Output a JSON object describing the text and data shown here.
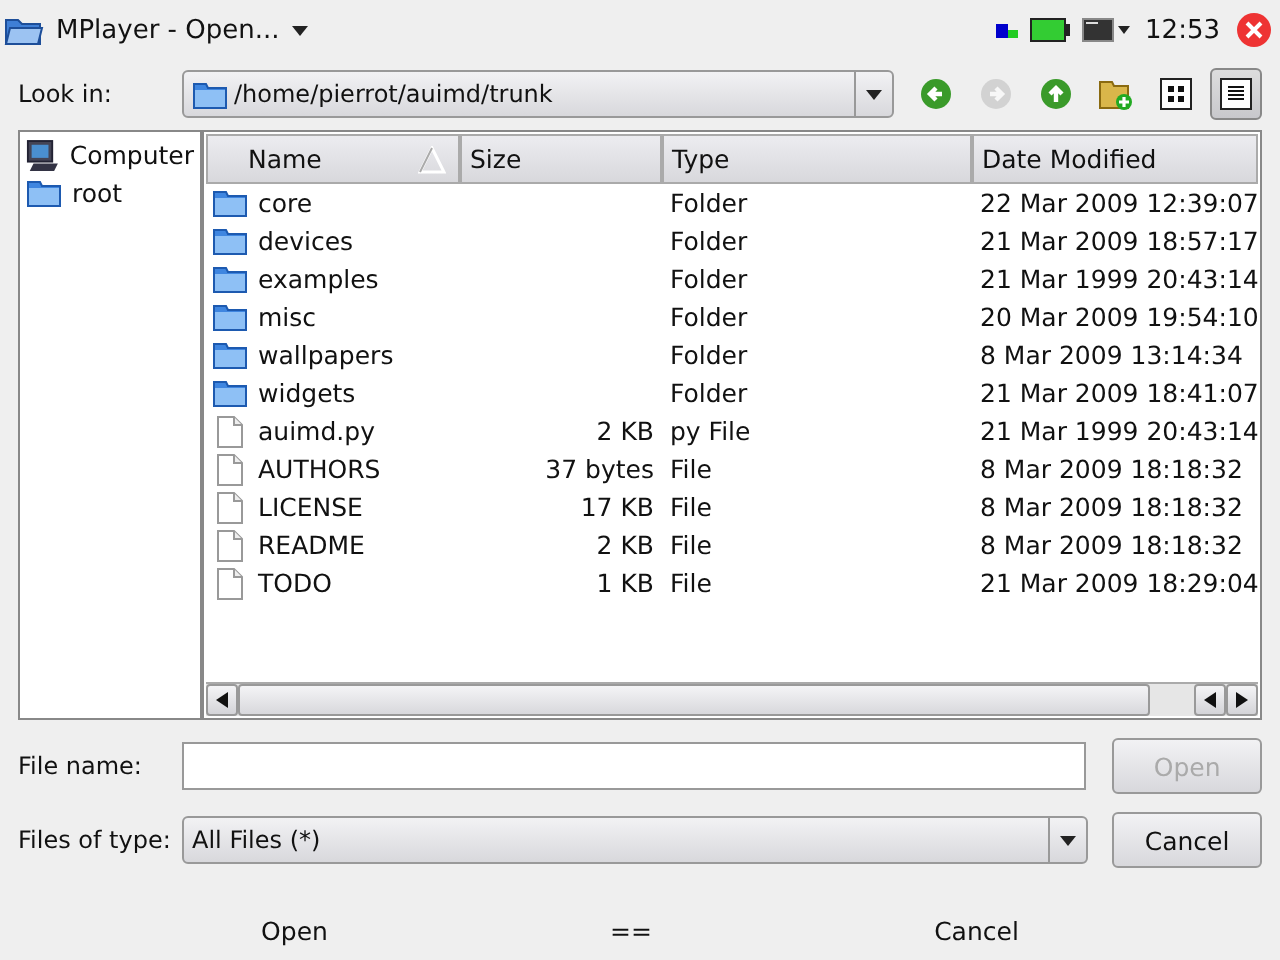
{
  "window": {
    "title": "MPlayer - Open..."
  },
  "status": {
    "time": "12:53"
  },
  "look_in": {
    "label": "Look in:",
    "path": "/home/pierrot/auimd/trunk"
  },
  "toolbar": [
    {
      "kind": "back",
      "disabled": false,
      "selected": false
    },
    {
      "kind": "forward",
      "disabled": true,
      "selected": false
    },
    {
      "kind": "up",
      "disabled": false,
      "selected": false
    },
    {
      "kind": "new-folder",
      "disabled": false,
      "selected": false
    },
    {
      "kind": "icon-view",
      "disabled": false,
      "selected": false
    },
    {
      "kind": "detail-view",
      "disabled": false,
      "selected": true
    }
  ],
  "sidebar": {
    "items": [
      {
        "kind": "computer",
        "label": "Computer"
      },
      {
        "kind": "folder",
        "label": "root"
      }
    ]
  },
  "table": {
    "columns": [
      {
        "label": "Name",
        "sorted": true
      },
      {
        "label": "Size",
        "sorted": false
      },
      {
        "label": "Type",
        "sorted": false
      },
      {
        "label": "Date Modified",
        "sorted": false
      }
    ],
    "rows": [
      {
        "kind": "folder",
        "name": "core",
        "size": "",
        "type": "Folder",
        "date": "22 Mar 2009 12:39:07"
      },
      {
        "kind": "folder",
        "name": "devices",
        "size": "",
        "type": "Folder",
        "date": "21 Mar 2009 18:57:17"
      },
      {
        "kind": "folder",
        "name": "examples",
        "size": "",
        "type": "Folder",
        "date": "21 Mar 1999 20:43:14"
      },
      {
        "kind": "folder",
        "name": "misc",
        "size": "",
        "type": "Folder",
        "date": "20 Mar 2009 19:54:10"
      },
      {
        "kind": "folder",
        "name": "wallpapers",
        "size": "",
        "type": "Folder",
        "date": "8 Mar 2009 13:14:34"
      },
      {
        "kind": "folder",
        "name": "widgets",
        "size": "",
        "type": "Folder",
        "date": "21 Mar 2009 18:41:07"
      },
      {
        "kind": "file",
        "name": "auimd.py",
        "size": "2 KB",
        "type": "py File",
        "date": "21 Mar 1999 20:43:14"
      },
      {
        "kind": "file",
        "name": "AUTHORS",
        "size": "37 bytes",
        "type": "File",
        "date": "8 Mar 2009 18:18:32"
      },
      {
        "kind": "file",
        "name": "LICENSE",
        "size": "17 KB",
        "type": "File",
        "date": "8 Mar 2009 18:18:32"
      },
      {
        "kind": "file",
        "name": "README",
        "size": "2 KB",
        "type": "File",
        "date": "8 Mar 2009 18:18:32"
      },
      {
        "kind": "file",
        "name": "TODO",
        "size": "1 KB",
        "type": "File",
        "date": "21 Mar 2009 18:29:04"
      }
    ]
  },
  "file_name": {
    "label": "File name:"
  },
  "file_type": {
    "label": "Files of type:",
    "value": "All Files (*)"
  },
  "buttons": [
    {
      "label": "Open",
      "disabled": true
    },
    {
      "label": "Cancel",
      "disabled": false
    }
  ],
  "softkeys": [
    "Open",
    "==",
    "Cancel"
  ]
}
